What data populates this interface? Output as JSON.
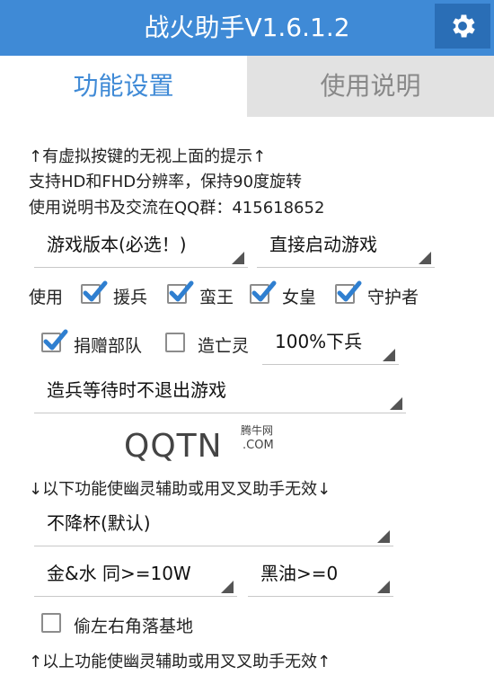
{
  "header": {
    "title": "战火助手V1.6.1.2",
    "gear_icon": "gear-icon"
  },
  "tabs": [
    {
      "label": "功能设置",
      "active": true
    },
    {
      "label": "使用说明",
      "active": false
    }
  ],
  "notes": {
    "virtual_keys": "↑有虚拟按键的无视上面的提示↑",
    "resolution": "支持HD和FHD分辨率，保持90度旋转",
    "qq_group": "使用说明书及交流在QQ群：415618652"
  },
  "spinners": {
    "game_version": "游戏版本(必选！)",
    "launch_mode": "直接启动游戏",
    "percent_troops": "100%下兵",
    "wait_mode": "造兵等待时不退出游戏",
    "trophy_mode": "不降杯(默认)",
    "gold_water": "金&水  同>=10W",
    "dark_oil": "黑油>=0"
  },
  "use_row": {
    "label": "使用",
    "items": [
      {
        "label": "援兵",
        "checked": true
      },
      {
        "label": "蛮王",
        "checked": true
      },
      {
        "label": "女皇",
        "checked": true
      },
      {
        "label": "守护者",
        "checked": true
      }
    ]
  },
  "options": {
    "donate": {
      "label": "捐赠部队",
      "checked": true
    },
    "undead": {
      "label": "造亡灵",
      "checked": false
    },
    "steal_corner": {
      "label": "偷左右角落基地",
      "checked": false
    }
  },
  "watermark": {
    "big": "QQTN",
    "small1": "腾牛网",
    "small2": ".COM"
  },
  "warnings": {
    "below": "↓以下功能使幽灵辅助或用叉叉助手无效↓",
    "above": "↑以上功能使幽灵辅助或用叉叉助手无效↑"
  },
  "colors": {
    "accent": "#3f8ad6",
    "check": "#2f7fd0"
  }
}
